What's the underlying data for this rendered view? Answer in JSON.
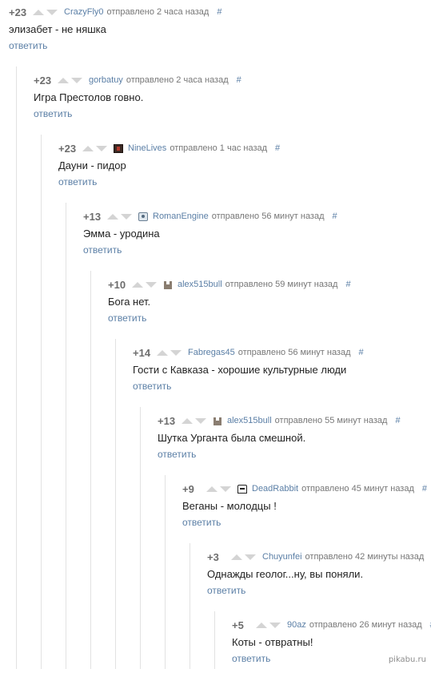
{
  "comments": [
    {
      "score": "+23",
      "author": "CrazyFly0",
      "sent": "отправлено 2 часа назад",
      "hash": "#",
      "text": "элизабет - не няшка",
      "reply": "ответить",
      "avatar": ""
    },
    {
      "score": "+23",
      "author": "gorbatuy",
      "sent": "отправлено 2 часа назад",
      "hash": "#",
      "text": "Игра Престолов говно.",
      "reply": "ответить",
      "avatar": ""
    },
    {
      "score": "+23",
      "author": "NineLives",
      "sent": "отправлено 1 час назад",
      "hash": "#",
      "text": "Дауни - пидор",
      "reply": "ответить",
      "avatar": "dark"
    },
    {
      "score": "+13",
      "author": "RomanEngine",
      "sent": "отправлено 56 минут назад",
      "hash": "#",
      "text": "Эмма - уродина",
      "reply": "ответить",
      "avatar": "cam"
    },
    {
      "score": "+10",
      "author": "alex515bull",
      "sent": "отправлено 59 минут назад",
      "hash": "#",
      "text": "Бога нет.",
      "reply": "ответить",
      "avatar": "tower"
    },
    {
      "score": "+14",
      "author": "Fabregas45",
      "sent": "отправлено 56 минут назад",
      "hash": "#",
      "text": "Гости с Кавказа - хорошие культурные люди",
      "reply": "ответить",
      "avatar": ""
    },
    {
      "score": "+13",
      "author": "alex515bull",
      "sent": "отправлено 55 минут назад",
      "hash": "#",
      "text": "Шутка Урганта была смешной.",
      "reply": "ответить",
      "avatar": "tower"
    },
    {
      "score": "+9",
      "author": "DeadRabbit",
      "sent": "отправлено 45 минут назад",
      "hash": "#",
      "text": "Веганы - молодцы !",
      "reply": "ответить",
      "avatar": "mask"
    },
    {
      "score": "+3",
      "author": "Chuyunfei",
      "sent": "отправлено 42 минуты назад",
      "hash": "#",
      "text": "Однажды геолог...ну, вы поняли.",
      "reply": "ответить",
      "avatar": ""
    },
    {
      "score": "+5",
      "author": "90az",
      "sent": "отправлено 26 минут назад",
      "hash": "#",
      "text": "Коты - отвратны!",
      "reply": "ответить",
      "avatar": ""
    }
  ],
  "watermark": "pikabu.ru"
}
